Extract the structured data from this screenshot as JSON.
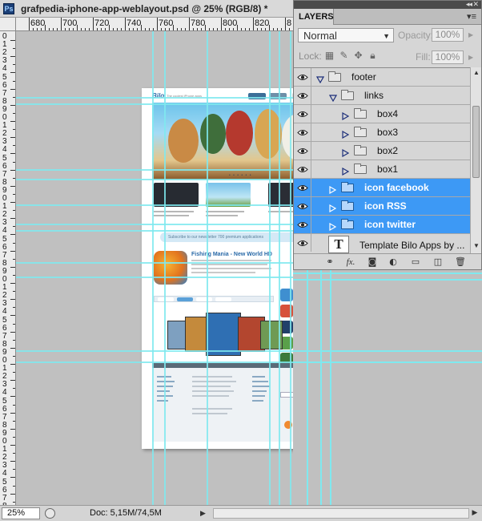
{
  "document": {
    "title": "grafpedia-iphone-app-weblayout.psd @ 25% (RGB/8) *",
    "app_badge": "Ps"
  },
  "ruler": {
    "horizontal_labels": [
      "680",
      "700",
      "720",
      "740",
      "760",
      "780",
      "800",
      "820",
      "8"
    ],
    "vertical_labels": [
      "0",
      "1",
      "2",
      "3",
      "4",
      "5",
      "6",
      "7",
      "8",
      "9",
      "0",
      "1",
      "2",
      "3",
      "4",
      "5",
      "6",
      "7",
      "8",
      "9",
      "0",
      "1",
      "2",
      "3",
      "4",
      "5",
      "6",
      "7",
      "8",
      "9",
      "0",
      "1",
      "2",
      "3",
      "4",
      "5",
      "6",
      "7",
      "8",
      "9",
      "0",
      "1",
      "2",
      "3",
      "4",
      "5",
      "6",
      "7",
      "8",
      "9",
      "0",
      "1",
      "2",
      "3",
      "4",
      "5",
      "6",
      "7",
      "8",
      "9"
    ]
  },
  "canvas": {
    "site_logo": "Bilo",
    "site_slogan": "The coolest iPhone apps",
    "promo_text": "Subscribe to our newsletter 700 premium applications",
    "featured_title": "Fishing Mania - New World HD",
    "hero_dots": "• • • • • •"
  },
  "layers_panel": {
    "tab_label": "LAYERS",
    "menu_icon": "panel-menu-icon",
    "blend_mode": "Normal",
    "opacity_label": "Opacity:",
    "opacity_value": "100%",
    "lock_label": "Lock:",
    "fill_label": "Fill:",
    "fill_value": "100%",
    "layers": [
      {
        "name": "footer",
        "type": "group",
        "expanded": true,
        "selected": false
      },
      {
        "name": "links",
        "type": "group",
        "expanded": true,
        "selected": false
      },
      {
        "name": "box4",
        "type": "group",
        "expanded": false,
        "selected": false
      },
      {
        "name": "box3",
        "type": "group",
        "expanded": false,
        "selected": false
      },
      {
        "name": "box2",
        "type": "group",
        "expanded": false,
        "selected": false
      },
      {
        "name": "box1",
        "type": "group",
        "expanded": false,
        "selected": false
      },
      {
        "name": "icon facebook",
        "type": "group",
        "expanded": false,
        "selected": true
      },
      {
        "name": "icon RSS",
        "type": "group",
        "expanded": false,
        "selected": true
      },
      {
        "name": "icon twitter",
        "type": "group",
        "expanded": false,
        "selected": true
      },
      {
        "name": "Template Bilo Apps by ...",
        "type": "text",
        "expanded": false,
        "selected": false
      }
    ],
    "text_layer_thumb": "T",
    "footer_icons": [
      "link-layers-icon",
      "fx-icon",
      "add-mask-icon",
      "adjustment-layer-icon",
      "new-group-icon",
      "new-layer-icon",
      "trash-icon"
    ],
    "fx_label": "fx.",
    "selection_color": "#3d99f5"
  },
  "status": {
    "zoom": "25%",
    "doc_size": "Doc: 5,15M/74,5M"
  },
  "colors": {
    "guide": "#7fe9ef",
    "panel_bg": "#d6d6d6",
    "canvas_bg": "#c0c0c0"
  }
}
